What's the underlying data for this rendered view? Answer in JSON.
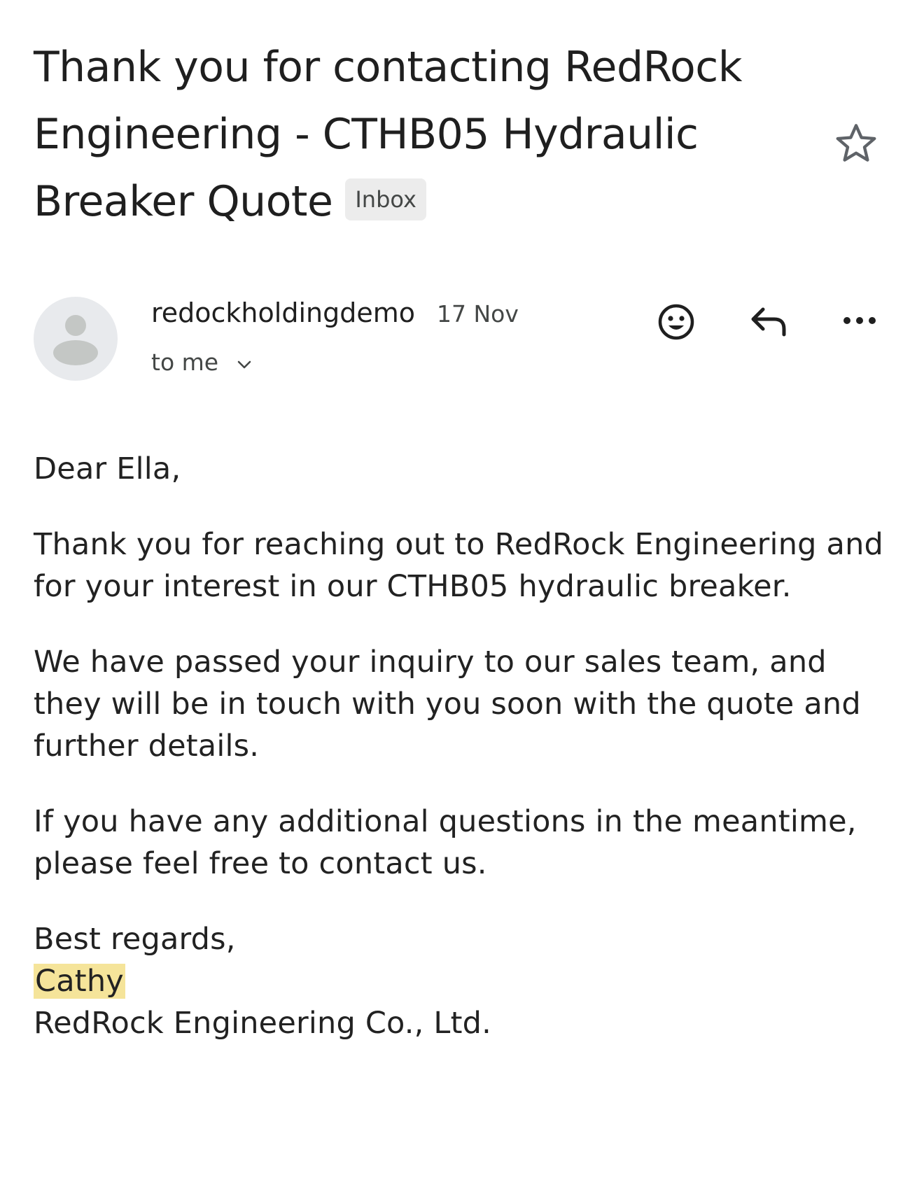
{
  "header": {
    "subject": "Thank you for contacting RedRock Engineering - CTHB05 Hydraulic Breaker Quote",
    "label": "Inbox",
    "star_icon": "star-outline-icon"
  },
  "message": {
    "sender_name": "redockholdingdemo",
    "date": "17 Nov",
    "recipient_label": "to me",
    "avatar_icon": "person-icon",
    "actions": {
      "emoji_icon": "smiley-icon",
      "reply_icon": "reply-icon",
      "more_icon": "more-horizontal-icon",
      "expand_icon": "chevron-down-icon"
    }
  },
  "body": {
    "greeting": "Dear Ella,",
    "paragraphs": [
      "Thank you for reaching out to RedRock Engineering and for your interest in our CTHB05 hydraulic breaker.",
      "We have passed your inquiry to our sales team, and they will be in touch with you soon with the quote and further details.",
      "If you have any additional questions in the meantime, please feel free to contact us."
    ],
    "signoff": "Best regards,",
    "signature_name": "Cathy",
    "signature_company": "RedRock Engineering Co., Ltd."
  },
  "colors": {
    "text": "#1f1f1f",
    "secondary_text": "#444746",
    "badge_bg": "#ececec",
    "avatar_bg": "#e8eaed",
    "highlight": "#f5e49a"
  }
}
